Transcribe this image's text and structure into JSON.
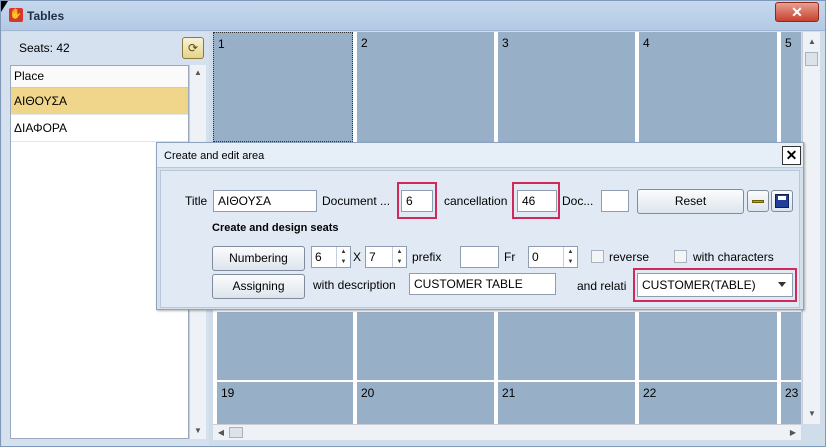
{
  "window": {
    "title": "Tables",
    "close_label": "✕"
  },
  "left_panel": {
    "seats_label": "Seats: 42",
    "list_header": "Place",
    "items": [
      {
        "label": "ΑΙΘΟΥΣΑ",
        "selected": true
      },
      {
        "label": "ΔΙΑΦΟΡΑ",
        "selected": false
      }
    ]
  },
  "grid": {
    "top_row": [
      "1",
      "2",
      "3",
      "4",
      "5"
    ],
    "bottom_row": [
      "19",
      "20",
      "21",
      "22",
      "23"
    ]
  },
  "dialog": {
    "title": "Create and edit area",
    "close_label": "✕",
    "title_label": "Title",
    "title_value": "ΑΙΘΟΥΣΑ",
    "document_label": "Document ...",
    "document_value": "6",
    "cancellation_label": "cancellation",
    "cancellation_value": "46",
    "doc_label": "Doc...",
    "doc_value": "",
    "reset_label": "Reset",
    "section_heading": "Create and design seats",
    "numbering_label": "Numbering",
    "rows_value": "6",
    "x_label": "X",
    "cols_value": "7",
    "prefix_label": "prefix",
    "prefix_value": "",
    "fr_label": "Fr",
    "fr_value": "0",
    "reverse_label": "reverse",
    "with_characters_label": "with characters",
    "assigning_label": "Assigning",
    "with_description_label": "with description",
    "description_value": "CUSTOMER TABLE",
    "relation_label": "and relati",
    "relation_value": "CUSTOMER(TABLE)"
  },
  "colors": {
    "cell": "#97b0c8",
    "highlight": "#d02a5a",
    "selected_item": "#f0d68a"
  }
}
